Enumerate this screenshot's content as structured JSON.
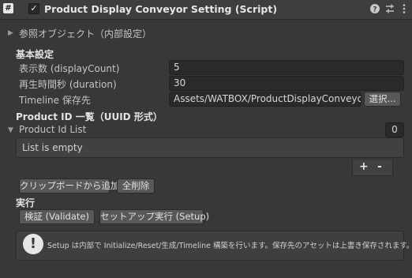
{
  "header": {
    "script_icon": "#",
    "enabled_check": "✓",
    "title": "Product Display Conveyor Setting (Script)",
    "icons": [
      "help-icon",
      "presets-icon",
      "more-icon"
    ]
  },
  "ref_foldout": {
    "label": "参照オブジェクト（内部設定）"
  },
  "basic": {
    "heading": "基本設定",
    "display_count_label": "表示数 (displayCount)",
    "display_count_value": "5",
    "duration_label": "再生時間秒 (duration)",
    "duration_value": "30",
    "timeline_label": "Timeline 保存先",
    "timeline_path": "Assets/WATBOX/ProductDisplayConveyo",
    "select_button": "選択..."
  },
  "product_ids": {
    "heading": "Product ID 一覧（UUID 形式）",
    "list_label": "Product Id List",
    "list_count": "0",
    "empty_text": "List is empty",
    "add": "+",
    "remove": "-",
    "paste_button": "クリップボードから追加",
    "clear_button": "全削除"
  },
  "run": {
    "heading": "実行",
    "validate_button": "検証 (Validate)",
    "setup_button": "セットアップ実行 (Setup)"
  },
  "help": {
    "icon": "!",
    "text": "Setup は内部で Initialize/Reset/生成/Timeline 構築を行います。保存先のアセットは上書き保存されます。"
  },
  "colors": {
    "background": "#383838",
    "field": "#2a2a2a",
    "button": "#585858"
  }
}
